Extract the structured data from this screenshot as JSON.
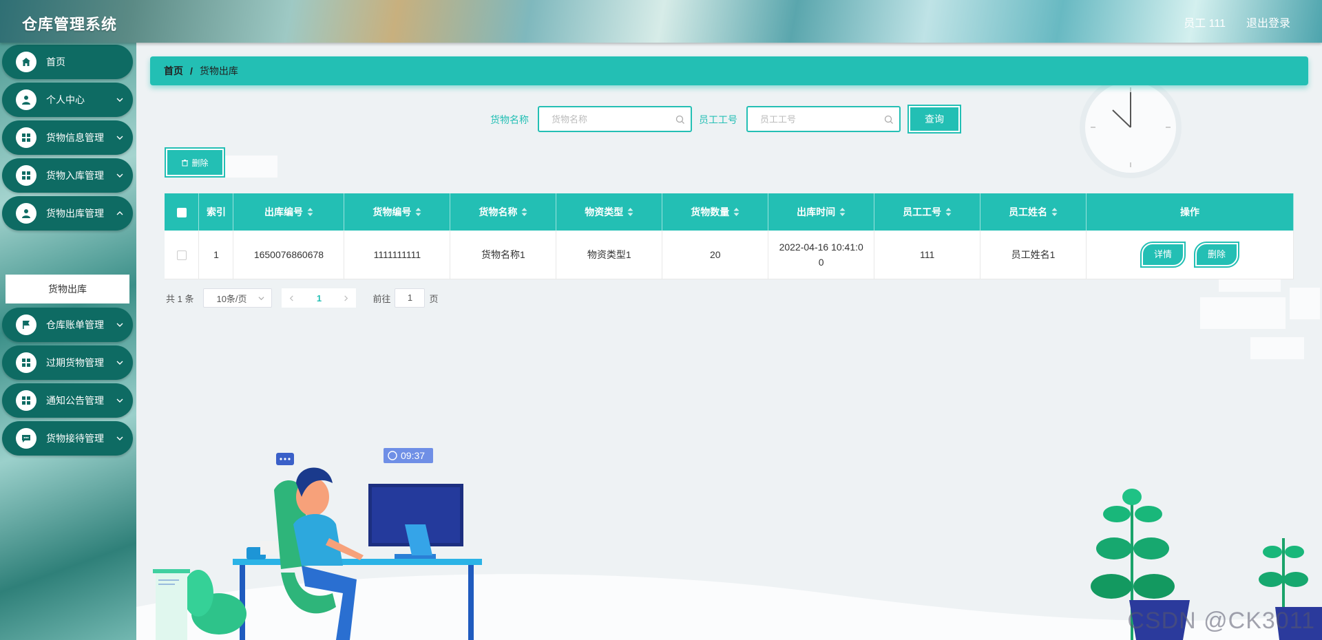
{
  "header": {
    "title": "仓库管理系统",
    "user": "员工 111",
    "logout": "退出登录"
  },
  "sidebar": {
    "items": [
      {
        "label": "首页",
        "icon": "home-icon"
      },
      {
        "label": "个人中心",
        "icon": "user-icon"
      },
      {
        "label": "货物信息管理",
        "icon": "grid-icon"
      },
      {
        "label": "货物入库管理",
        "icon": "grid-icon"
      },
      {
        "label": "货物出库管理",
        "icon": "user-icon"
      },
      {
        "label": "仓库账单管理",
        "icon": "flag-icon"
      },
      {
        "label": "过期货物管理",
        "icon": "grid-icon"
      },
      {
        "label": "通知公告管理",
        "icon": "grid-icon"
      },
      {
        "label": "货物接待管理",
        "icon": "chat-icon"
      }
    ],
    "active_sub": "货物出库"
  },
  "breadcrumb": {
    "home": "首页",
    "separator": "/",
    "current": "货物出库"
  },
  "search": {
    "name_label": "货物名称",
    "name_placeholder": "货物名称",
    "staff_label": "员工工号",
    "staff_placeholder": "员工工号",
    "button": "查询"
  },
  "bulk_delete": "删除",
  "table": {
    "headers": [
      "索引",
      "出库编号",
      "货物编号",
      "货物名称",
      "物资类型",
      "货物数量",
      "出库时间",
      "员工工号",
      "员工姓名",
      "操作"
    ],
    "rows": [
      {
        "index": "1",
        "out_no": "1650076860678",
        "goods_no": "1111111111",
        "goods_name": "货物名称1",
        "type": "物资类型1",
        "qty": "20",
        "time_line1": "2022-04-16 10:41:0",
        "time_line2": "0",
        "staff_no": "111",
        "staff_name": "员工姓名1",
        "detail_btn": "详情",
        "delete_btn": "删除"
      }
    ]
  },
  "pager": {
    "total": "共 1 条",
    "page_size": "10条/页",
    "current": "1",
    "goto_label": "前往",
    "goto_value": "1",
    "page_suffix": "页"
  },
  "illustration": {
    "clock_time": "09:37"
  },
  "watermark": "CSDN @CK3011",
  "colors": {
    "accent": "#23bfb4",
    "sidebar_item": "#0e6b63"
  }
}
